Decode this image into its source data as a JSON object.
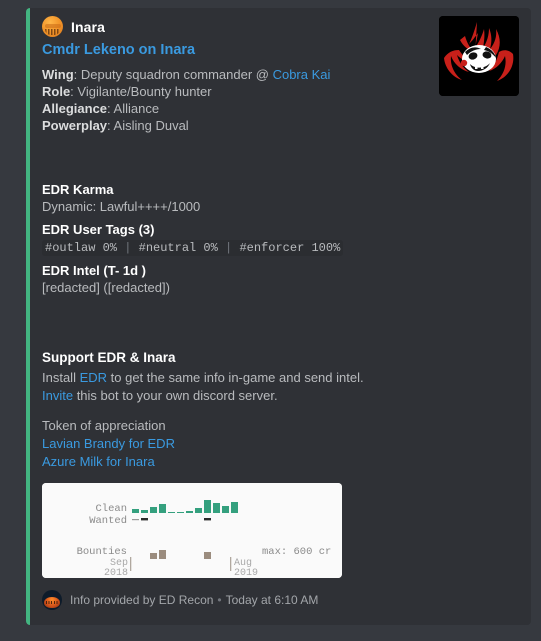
{
  "embed": {
    "accent_color": "#43b581",
    "background": "#2f3136",
    "page_background": "#36393f",
    "author": {
      "icon_name": "inara-orange-emblem-icon",
      "name": "Inara"
    },
    "title": "Cmdr Lekeno on Inara",
    "title_color": "#3a9ae0",
    "thumbnail": {
      "icon_name": "cobra-kai-red-flame-skull-thumbnail",
      "background": "#000000",
      "flame_color": "#d0241c"
    },
    "description_lines": [
      {
        "key": "Wing",
        "sep": ": ",
        "value": "Deputy squadron commander @ ",
        "link": "Cobra Kai"
      },
      {
        "key": "Role",
        "sep": ": ",
        "value": "Vigilante/Bounty hunter",
        "link": ""
      },
      {
        "key": "Allegiance",
        "sep": ": ",
        "value": "Alliance",
        "link": ""
      },
      {
        "key": "Powerplay",
        "sep": ": ",
        "value": "Aisling Duval",
        "link": ""
      }
    ],
    "fields": [
      {
        "name": "EDR Karma",
        "value": "Dynamic: Lawful++++/1000"
      },
      {
        "name": "EDR User Tags (3)",
        "value": "#outlaw 0%  |  #neutral 0%  |  #enforcer 100%"
      },
      {
        "name": "EDR Intel (T- 1d  )",
        "value": "[redacted] ([redacted])"
      }
    ],
    "tags": {
      "outlaw": "#outlaw 0%",
      "neutral": "#neutral 0%",
      "enforcer": "#enforcer 100%",
      "separator": "|"
    },
    "support": {
      "title": "Support EDR & Inara",
      "line1_pre": "Install ",
      "line1_link": "EDR",
      "line1_post": " to get the same info in-game and send intel.",
      "line2_link": "Invite",
      "line2_post": " this bot to your own discord server.",
      "token_label": "Token of appreciation",
      "link_brandy": "Lavian Brandy for EDR",
      "link_milk": "Azure Milk for Inara"
    },
    "footer": {
      "icon_name": "ed-recon-avatar-icon",
      "text": "Info provided by ED Recon",
      "separator": "•",
      "timestamp": "Today at 6:10 AM"
    }
  },
  "chart_data": {
    "type": "bar",
    "title": "",
    "background": "#fafafa",
    "xlabel": "",
    "ylabel": "",
    "row_labels": [
      "Clean",
      "Wanted",
      "Bounties"
    ],
    "axis_start_label": "Sep\n2018",
    "axis_end_label": "Aug\n2019",
    "axis_start_month": "Sep",
    "axis_start_year": "2018",
    "axis_end_month": "Aug",
    "axis_end_year": "2019",
    "annotation": "max: 600 cr",
    "max_bounty_cr": 600,
    "colors": {
      "clean": "#34a07e",
      "wanted": "#2b2b2b",
      "bounties": "#9b8c7e",
      "label": "#8b8b8b",
      "tick": "#b0a89f"
    },
    "series": [
      {
        "name": "Clean",
        "color": "#34a07e",
        "values": [
          4,
          3,
          6,
          9,
          1,
          1,
          2,
          5,
          13,
          10,
          7,
          11
        ]
      },
      {
        "name": "Wanted",
        "color": "#2b2b2b",
        "values": [
          1,
          2,
          0,
          0,
          0,
          0,
          0,
          0,
          2,
          0,
          0,
          0
        ]
      },
      {
        "name": "Bounties",
        "color": "#9b8c7e",
        "values": [
          0,
          0,
          6,
          9,
          0,
          0,
          0,
          0,
          7,
          0,
          0,
          0
        ]
      }
    ],
    "categories": [
      "1",
      "2",
      "3",
      "4",
      "5",
      "6",
      "7",
      "8",
      "9",
      "10",
      "11",
      "12"
    ],
    "ylim": [
      0,
      14
    ],
    "grid": false,
    "legend_position": "left"
  }
}
